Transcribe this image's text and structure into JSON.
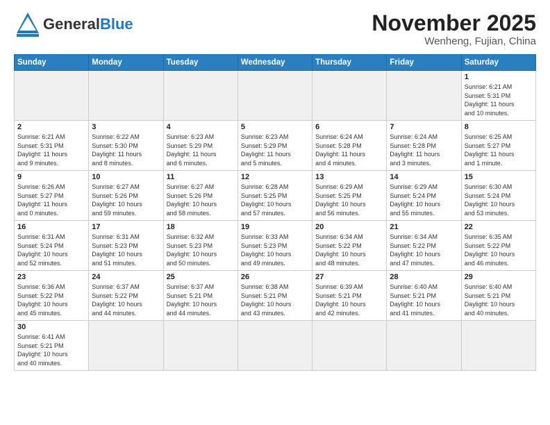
{
  "header": {
    "logo_general": "General",
    "logo_blue": "Blue",
    "title": "November 2025",
    "subtitle": "Wenheng, Fujian, China"
  },
  "days_of_week": [
    "Sunday",
    "Monday",
    "Tuesday",
    "Wednesday",
    "Thursday",
    "Friday",
    "Saturday"
  ],
  "weeks": [
    [
      {
        "date": "",
        "info": ""
      },
      {
        "date": "",
        "info": ""
      },
      {
        "date": "",
        "info": ""
      },
      {
        "date": "",
        "info": ""
      },
      {
        "date": "",
        "info": ""
      },
      {
        "date": "",
        "info": ""
      },
      {
        "date": "1",
        "info": "Sunrise: 6:21 AM\nSunset: 5:31 PM\nDaylight: 11 hours\nand 10 minutes."
      }
    ],
    [
      {
        "date": "2",
        "info": "Sunrise: 6:21 AM\nSunset: 5:31 PM\nDaylight: 11 hours\nand 9 minutes."
      },
      {
        "date": "3",
        "info": "Sunrise: 6:22 AM\nSunset: 5:30 PM\nDaylight: 11 hours\nand 8 minutes."
      },
      {
        "date": "4",
        "info": "Sunrise: 6:23 AM\nSunset: 5:29 PM\nDaylight: 11 hours\nand 6 minutes."
      },
      {
        "date": "5",
        "info": "Sunrise: 6:23 AM\nSunset: 5:29 PM\nDaylight: 11 hours\nand 5 minutes."
      },
      {
        "date": "6",
        "info": "Sunrise: 6:24 AM\nSunset: 5:28 PM\nDaylight: 11 hours\nand 4 minutes."
      },
      {
        "date": "7",
        "info": "Sunrise: 6:24 AM\nSunset: 5:28 PM\nDaylight: 11 hours\nand 3 minutes."
      },
      {
        "date": "8",
        "info": "Sunrise: 6:25 AM\nSunset: 5:27 PM\nDaylight: 11 hours\nand 1 minute."
      }
    ],
    [
      {
        "date": "9",
        "info": "Sunrise: 6:26 AM\nSunset: 5:27 PM\nDaylight: 11 hours\nand 0 minutes."
      },
      {
        "date": "10",
        "info": "Sunrise: 6:27 AM\nSunset: 5:26 PM\nDaylight: 10 hours\nand 59 minutes."
      },
      {
        "date": "11",
        "info": "Sunrise: 6:27 AM\nSunset: 5:26 PM\nDaylight: 10 hours\nand 58 minutes."
      },
      {
        "date": "12",
        "info": "Sunrise: 6:28 AM\nSunset: 5:25 PM\nDaylight: 10 hours\nand 57 minutes."
      },
      {
        "date": "13",
        "info": "Sunrise: 6:29 AM\nSunset: 5:25 PM\nDaylight: 10 hours\nand 56 minutes."
      },
      {
        "date": "14",
        "info": "Sunrise: 6:29 AM\nSunset: 5:24 PM\nDaylight: 10 hours\nand 55 minutes."
      },
      {
        "date": "15",
        "info": "Sunrise: 6:30 AM\nSunset: 5:24 PM\nDaylight: 10 hours\nand 53 minutes."
      }
    ],
    [
      {
        "date": "16",
        "info": "Sunrise: 6:31 AM\nSunset: 5:24 PM\nDaylight: 10 hours\nand 52 minutes."
      },
      {
        "date": "17",
        "info": "Sunrise: 6:31 AM\nSunset: 5:23 PM\nDaylight: 10 hours\nand 51 minutes."
      },
      {
        "date": "18",
        "info": "Sunrise: 6:32 AM\nSunset: 5:23 PM\nDaylight: 10 hours\nand 50 minutes."
      },
      {
        "date": "19",
        "info": "Sunrise: 6:33 AM\nSunset: 5:23 PM\nDaylight: 10 hours\nand 49 minutes."
      },
      {
        "date": "20",
        "info": "Sunrise: 6:34 AM\nSunset: 5:22 PM\nDaylight: 10 hours\nand 48 minutes."
      },
      {
        "date": "21",
        "info": "Sunrise: 6:34 AM\nSunset: 5:22 PM\nDaylight: 10 hours\nand 47 minutes."
      },
      {
        "date": "22",
        "info": "Sunrise: 6:35 AM\nSunset: 5:22 PM\nDaylight: 10 hours\nand 46 minutes."
      }
    ],
    [
      {
        "date": "23",
        "info": "Sunrise: 6:36 AM\nSunset: 5:22 PM\nDaylight: 10 hours\nand 45 minutes."
      },
      {
        "date": "24",
        "info": "Sunrise: 6:37 AM\nSunset: 5:22 PM\nDaylight: 10 hours\nand 44 minutes."
      },
      {
        "date": "25",
        "info": "Sunrise: 6:37 AM\nSunset: 5:21 PM\nDaylight: 10 hours\nand 44 minutes."
      },
      {
        "date": "26",
        "info": "Sunrise: 6:38 AM\nSunset: 5:21 PM\nDaylight: 10 hours\nand 43 minutes."
      },
      {
        "date": "27",
        "info": "Sunrise: 6:39 AM\nSunset: 5:21 PM\nDaylight: 10 hours\nand 42 minutes."
      },
      {
        "date": "28",
        "info": "Sunrise: 6:40 AM\nSunset: 5:21 PM\nDaylight: 10 hours\nand 41 minutes."
      },
      {
        "date": "29",
        "info": "Sunrise: 6:40 AM\nSunset: 5:21 PM\nDaylight: 10 hours\nand 40 minutes."
      }
    ],
    [
      {
        "date": "30",
        "info": "Sunrise: 6:41 AM\nSunset: 5:21 PM\nDaylight: 10 hours\nand 40 minutes."
      },
      {
        "date": "",
        "info": ""
      },
      {
        "date": "",
        "info": ""
      },
      {
        "date": "",
        "info": ""
      },
      {
        "date": "",
        "info": ""
      },
      {
        "date": "",
        "info": ""
      },
      {
        "date": "",
        "info": ""
      }
    ]
  ]
}
